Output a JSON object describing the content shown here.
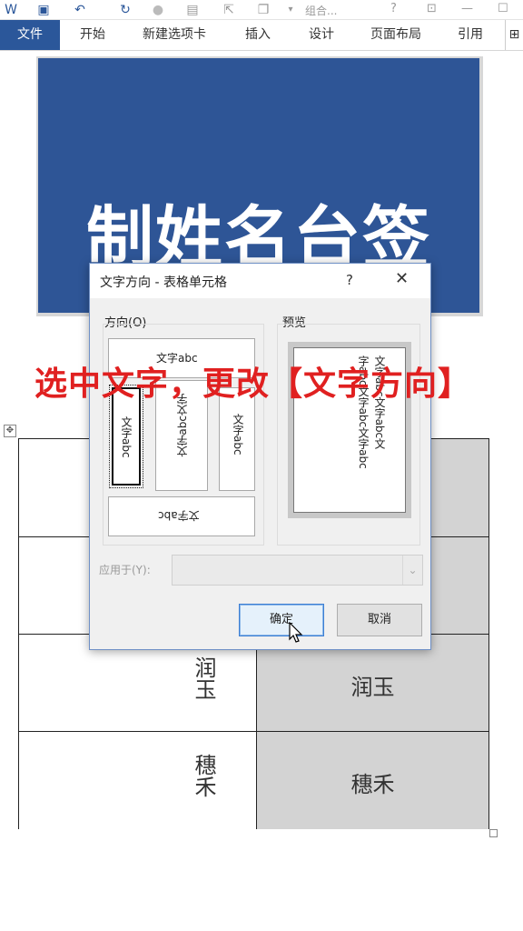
{
  "ribbon": {
    "tabs": [
      "文件",
      "开始",
      "新建选项卡",
      "插入",
      "设计",
      "页面布局",
      "引用"
    ],
    "window_title": "组合..."
  },
  "icons": [
    "word-icon",
    "save-icon",
    "undo-icon",
    "redo-icon",
    "circle-icon",
    "shape-icon",
    "help-icon",
    "restore-icon",
    "maximize-icon"
  ],
  "banner": {
    "title": "制姓名台签"
  },
  "caption": "选中文字，更改【文字方向】",
  "table": {
    "rows": [
      {
        "left": "",
        "right": ""
      },
      {
        "left": "",
        "right": ""
      },
      {
        "left": "润玉",
        "right": "润玉"
      },
      {
        "left": "穗禾",
        "right": "穗禾"
      }
    ]
  },
  "dialog": {
    "title": "文字方向 - 表格单元格",
    "help": "?",
    "close": "✕",
    "orientation_label": "方向(O)",
    "orientation_options": {
      "top": "文字abc",
      "left_selected": "文字abc",
      "middle": "文字abc文字",
      "right": "文字abc",
      "bottom": "文字abc"
    },
    "preview_label": "预览",
    "preview_lines": [
      "文字abc文字abc文",
      "字abc文字abc文字abc"
    ],
    "apply_label": "应用于(Y):",
    "apply_value": "",
    "ok_label": "确定",
    "cancel_label": "取消"
  },
  "colors": {
    "ribbon_accent": "#2b579a",
    "banner_bg": "#2e5596",
    "caption_red": "#e02020",
    "cell_gray": "#d3d3d3"
  }
}
